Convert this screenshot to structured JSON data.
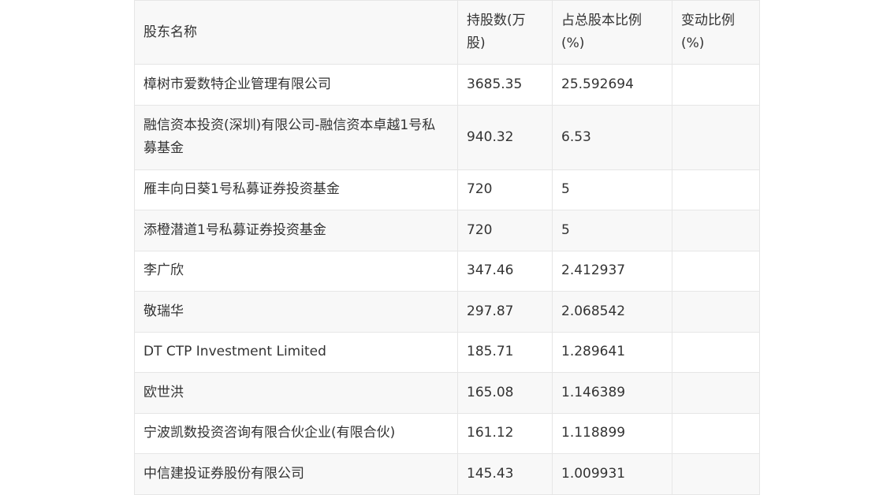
{
  "table": {
    "headers": [
      "股东名称",
      "持股数(万股)",
      "占总股本比例(%)",
      "变动比例(%)"
    ],
    "rows": [
      {
        "name": "樟树市爱数特企业管理有限公司",
        "shares": "3685.35",
        "ratio": "25.592694",
        "change": ""
      },
      {
        "name": "融信资本投资(深圳)有限公司-融信资本卓越1号私募基金",
        "shares": "940.32",
        "ratio": "6.53",
        "change": ""
      },
      {
        "name": "雁丰向日葵1号私募证券投资基金",
        "shares": "720",
        "ratio": "5",
        "change": ""
      },
      {
        "name": "添橙潜道1号私募证券投资基金",
        "shares": "720",
        "ratio": "5",
        "change": ""
      },
      {
        "name": "李广欣",
        "shares": "347.46",
        "ratio": "2.412937",
        "change": ""
      },
      {
        "name": "敬瑞华",
        "shares": "297.87",
        "ratio": "2.068542",
        "change": ""
      },
      {
        "name": "DT CTP Investment Limited",
        "shares": "185.71",
        "ratio": "1.289641",
        "change": ""
      },
      {
        "name": "欧世洪",
        "shares": "165.08",
        "ratio": "1.146389",
        "change": ""
      },
      {
        "name": "宁波凯数投资咨询有限合伙企业(有限合伙)",
        "shares": "161.12",
        "ratio": "1.118899",
        "change": ""
      },
      {
        "name": "中信建投证券股份有限公司",
        "shares": "145.43",
        "ratio": "1.009931",
        "change": ""
      }
    ]
  }
}
